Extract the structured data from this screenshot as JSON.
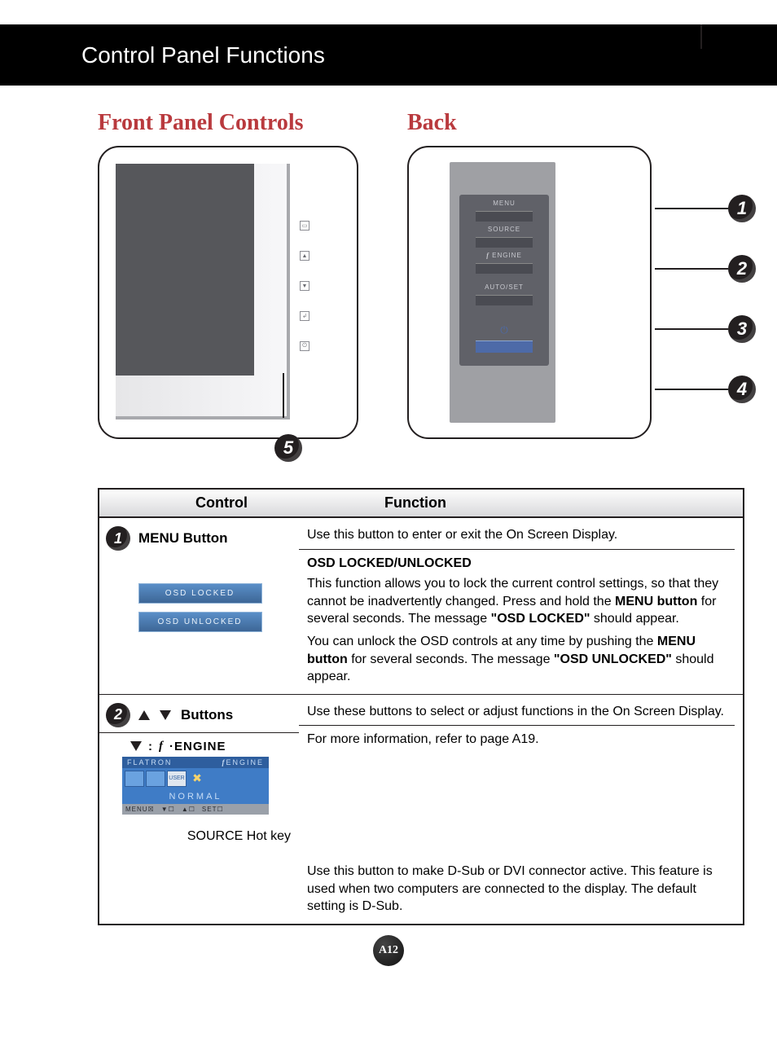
{
  "header": {
    "title": "Control Panel Functions"
  },
  "sections": {
    "front_title": "Front Panel Controls",
    "back_title": "Back"
  },
  "front_icons": {
    "menu_glyph": "▭",
    "up_glyph": "▲",
    "down_glyph": "▼",
    "set_glyph": "↲",
    "power_glyph": "⏻"
  },
  "back_panel": {
    "menu": "MENU",
    "source": "SOURCE",
    "engine": "ENGINE",
    "autoset": "AUTO/SET"
  },
  "callouts": {
    "n1": "1",
    "n2": "2",
    "n3": "3",
    "n4": "4",
    "n5": "5"
  },
  "table": {
    "head_control": "Control",
    "head_function": "Function",
    "row1": {
      "label": "MENU Button",
      "desc": "Use this button to enter or exit the On Screen Display.",
      "osd_title": "OSD LOCKED/UNLOCKED",
      "osd_p1_a": "This function allows you to lock the current control settings, so that they cannot be inadvertently changed. Press and hold the ",
      "osd_p1_bold": "MENU button",
      "osd_p1_b": " for several seconds. The message ",
      "osd_p1_q": "\"OSD LOCKED\"",
      "osd_p1_c": " should appear.",
      "osd_p2_a": "You can unlock the OSD controls at any time by pushing the ",
      "osd_p2_bold": "MENU button",
      "osd_p2_b": " for several seconds. The message ",
      "osd_p2_q": "\"OSD UNLOCKED\"",
      "osd_p2_c": " should appear.",
      "chip_locked": "OSD LOCKED",
      "chip_unlocked": "OSD UNLOCKED"
    },
    "row2": {
      "label": "Buttons",
      "desc": "Use these buttons to select or adjust functions in the On Screen Display.",
      "engine_hint": "For more information, refer to page A19.",
      "engine_prefix": "ENGINE",
      "fe_flatron": "FLATRON",
      "fe_user": "USER",
      "fe_normal": "NORMAL",
      "fe_menu": "MENU☒",
      "fe_v": "▼☐",
      "fe_a": "▲☐",
      "fe_set": "SET☐"
    },
    "row3": {
      "label": "SOURCE Hot key",
      "desc": "Use this button to make D-Sub or DVI connector active. This feature is used when two computers are connected to the display. The default setting is D-Sub."
    }
  },
  "page_number": "A12"
}
